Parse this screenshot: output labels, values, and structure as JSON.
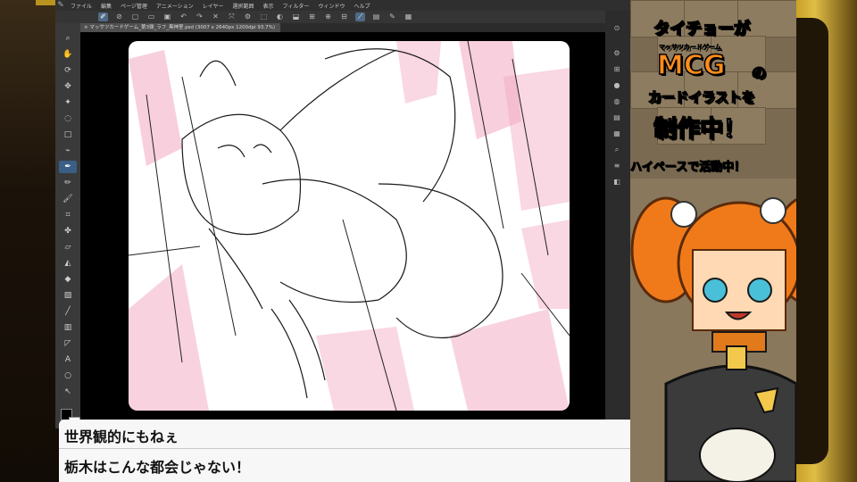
{
  "menu": {
    "items": [
      "ファイル",
      "編集",
      "ページ管理",
      "アニメーション",
      "レイヤー",
      "選択範囲",
      "表示",
      "フィルター",
      "ウィンドウ",
      "ヘルプ"
    ]
  },
  "document": {
    "tab_label": "× マッサツカードゲーム_第3弾_ラフ_黒神室.psd (3007 x 2640px 1200dpi 93.7%)"
  },
  "tools": [
    "magnifier-icon",
    "hand-icon",
    "rotate-icon",
    "move-icon",
    "wand-icon",
    "lasso-icon",
    "select-rect-icon",
    "eyedropper-icon",
    "pen-icon",
    "pencil-icon",
    "brush-icon",
    "airbrush-icon",
    "decoration-icon",
    "eraser-icon",
    "blend-icon",
    "fill-icon",
    "gradient-icon",
    "figure-icon",
    "frame-icon",
    "ruler-icon",
    "text-icon",
    "balloon-icon",
    "correct-line-icon"
  ],
  "dialog": {
    "line1": "世界観的にもねぇ",
    "line2": "栃木はこんな都会じゃない！"
  },
  "side_panel": {
    "title_line1": "タイチョーが",
    "title_small": "マッサツカードゲーム",
    "title_big": "MCG",
    "title_no": "の",
    "title_line3": "カードイラストを",
    "title_line4": "制作中！",
    "subtitle": "ハイペースで活動中！"
  },
  "colors": {
    "menu_bg": "#2f2f2f",
    "canvas_bg": "#000000",
    "paper": "#ffffff",
    "building_pink": "#f2a7c0",
    "accent_active": "#3b5e86",
    "title_fill": "#ffffff",
    "title_stroke": "#000000",
    "bezel_gold": "#c9a227"
  }
}
